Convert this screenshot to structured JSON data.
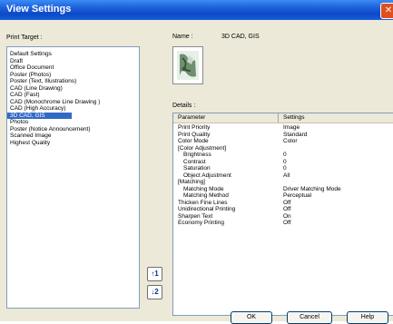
{
  "window": {
    "title": "View Settings"
  },
  "print_target": {
    "label": "Print Target :",
    "items": [
      "Default Settings",
      "Draft",
      "Office Document",
      "Poster (Photos)",
      "Poster (Text, Illustrations)",
      "CAD (Line Drawing)",
      "CAD (Fast)",
      "CAD (Monochrome Line Drawing )",
      "CAD (High Accuracy)",
      "3D CAD, GIS",
      "Photos",
      "Poster (Notice Announcement)",
      "Scanned Image",
      "Highest Quality"
    ],
    "selected": "3D CAD, GIS"
  },
  "name": {
    "label": "Name :",
    "value": "3D CAD, GIS"
  },
  "details": {
    "label": "Details :",
    "columns": [
      "Parameter",
      "Settings"
    ],
    "rows": [
      {
        "parameter": "Print Priority",
        "setting": "Image"
      },
      {
        "parameter": "Print Quality",
        "setting": "Standard"
      },
      {
        "parameter": "Color Mode",
        "setting": "Color"
      },
      {
        "parameter": "[Color Adjustment]",
        "setting": ""
      },
      {
        "parameter": "Brightness",
        "setting": "0",
        "indent": true
      },
      {
        "parameter": "Contrast",
        "setting": "0",
        "indent": true
      },
      {
        "parameter": "Saturation",
        "setting": "0",
        "indent": true
      },
      {
        "parameter": "Object Adjustment",
        "setting": "All",
        "indent": true
      },
      {
        "parameter": "[Matching]",
        "setting": ""
      },
      {
        "parameter": "Matching Mode",
        "setting": "Driver Matching Mode",
        "indent": true
      },
      {
        "parameter": "Matching Method",
        "setting": "Perceptual",
        "indent": true
      },
      {
        "parameter": "Thicken Fine Lines",
        "setting": "Off"
      },
      {
        "parameter": "Unidirectional Printing",
        "setting": "Off"
      },
      {
        "parameter": "Sharpen Text",
        "setting": "On"
      },
      {
        "parameter": "Economy Printing",
        "setting": "Off"
      }
    ]
  },
  "side_buttons": {
    "up_label": "1",
    "down_label": "2"
  },
  "buttons": {
    "ok": "OK",
    "cancel": "Cancel",
    "help": "Help"
  },
  "colors": {
    "titlebar": "#0a49c8",
    "selection": "#316ac5",
    "dialog_bg": "#ece9d8"
  }
}
